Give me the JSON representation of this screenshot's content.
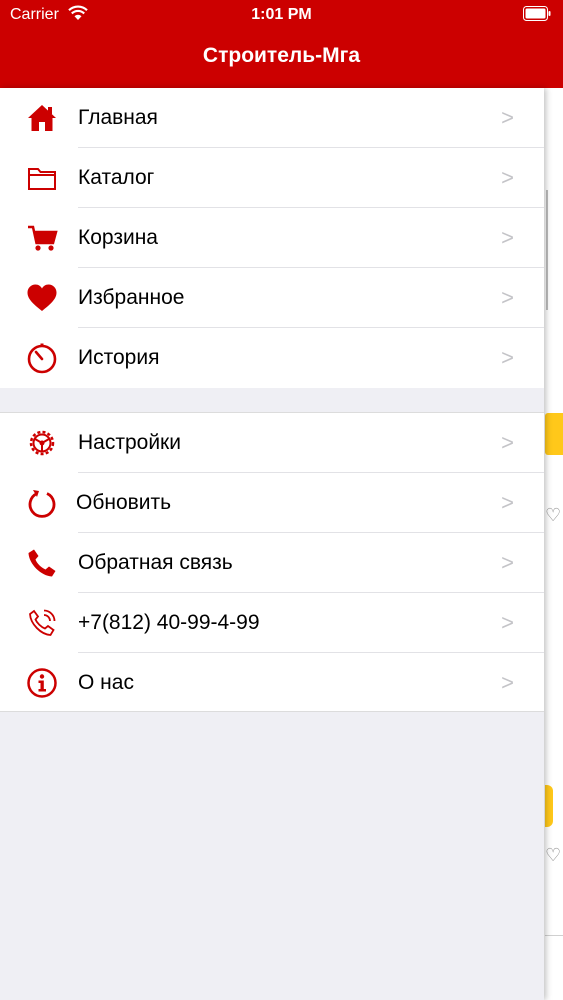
{
  "status_bar": {
    "carrier": "Carrier",
    "time": "1:01 PM"
  },
  "header": {
    "title": "Строитель-Мга"
  },
  "menu_main": [
    {
      "label": "Главная",
      "icon": "home-icon"
    },
    {
      "label": "Каталог",
      "icon": "folder-icon"
    },
    {
      "label": "Корзина",
      "icon": "cart-icon"
    },
    {
      "label": "Избранное",
      "icon": "heart-icon"
    },
    {
      "label": "История",
      "icon": "history-icon"
    }
  ],
  "menu_secondary": [
    {
      "label": "Настройки",
      "icon": "settings-icon"
    },
    {
      "label": "Обновить",
      "icon": "refresh-icon"
    },
    {
      "label": "Обратная связь",
      "icon": "phone-icon"
    },
    {
      "label": "+7(812) 40-99-4-99",
      "icon": "phone-call-icon"
    },
    {
      "label": "О нас",
      "icon": "info-icon"
    }
  ],
  "chevron": ">",
  "colors": {
    "brand": "#cc0000",
    "accent": "#ffc81a"
  }
}
